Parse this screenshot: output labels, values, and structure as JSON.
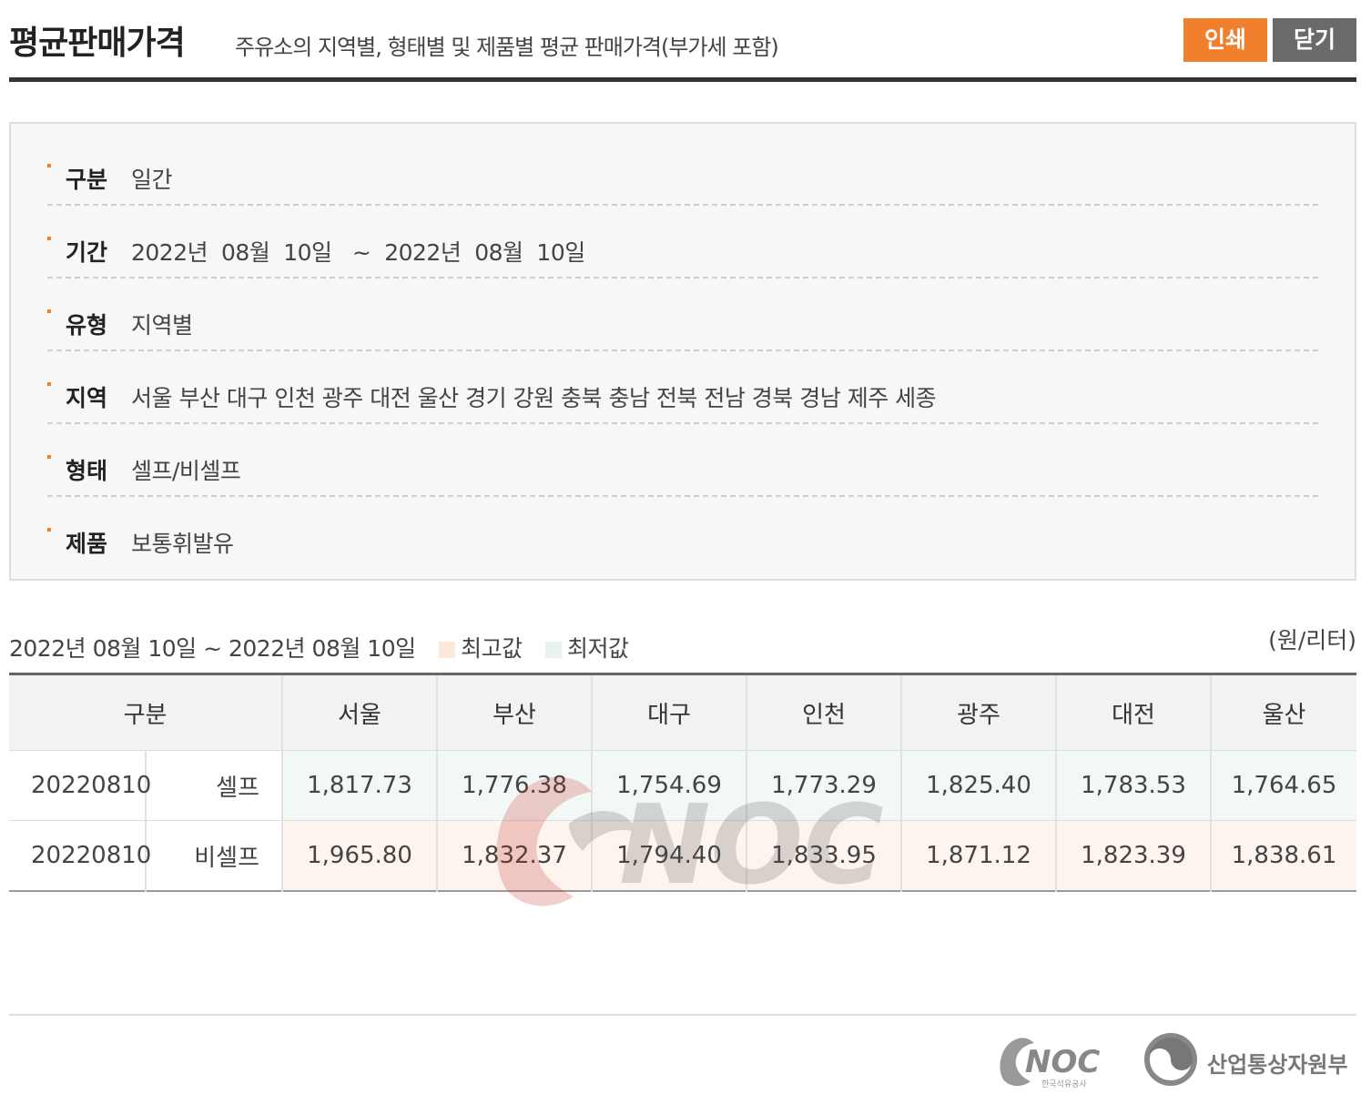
{
  "header": {
    "title": "평균판매가격",
    "subtitle": "주유소의 지역별, 형태별 및 제품별 평균 판매가격(부가세 포함)",
    "print_label": "인쇄",
    "close_label": "닫기"
  },
  "filters": [
    {
      "label": "구분",
      "value": "일간"
    },
    {
      "label": "기간",
      "value": "2022년  08월  10일   ~  2022년  08월  10일"
    },
    {
      "label": "유형",
      "value": "지역별"
    },
    {
      "label": "지역",
      "value": "서울 부산 대구 인천 광주 대전 울산 경기 강원 충북 충남 전북 전남 경북 경남 제주 세종"
    },
    {
      "label": "형태",
      "value": "셀프/비셀프"
    },
    {
      "label": "제품",
      "value": "보통휘발유"
    }
  ],
  "summary": {
    "range": "2022년 08월 10일 ~ 2022년 08월 10일",
    "legend_high": "최고값",
    "legend_low": "최저값",
    "unit": "(원/리터)"
  },
  "table": {
    "header_first": "구분",
    "regions": [
      "서울",
      "부산",
      "대구",
      "인천",
      "광주",
      "대전",
      "울산"
    ],
    "rows": [
      {
        "date": "20220810",
        "type": "셀프",
        "values": [
          "1,817.73",
          "1,776.38",
          "1,754.69",
          "1,773.29",
          "1,825.40",
          "1,783.53",
          "1,764.65"
        ]
      },
      {
        "date": "20220810",
        "type": "비셀프",
        "values": [
          "1,965.80",
          "1,832.37",
          "1,794.40",
          "1,833.95",
          "1,871.12",
          "1,823.39",
          "1,838.61"
        ]
      }
    ]
  },
  "watermark": {
    "text": "NOC"
  },
  "footer": {
    "knoc_logo_text": "NOC",
    "knoc_sub": "한국석유공사",
    "motie_text": "산업통상자원부"
  },
  "colors": {
    "accent": "#f07f2e",
    "close_button": "#6a6a6a",
    "high_cell": "#fdf4ee",
    "low_cell": "#f2f8f5"
  }
}
